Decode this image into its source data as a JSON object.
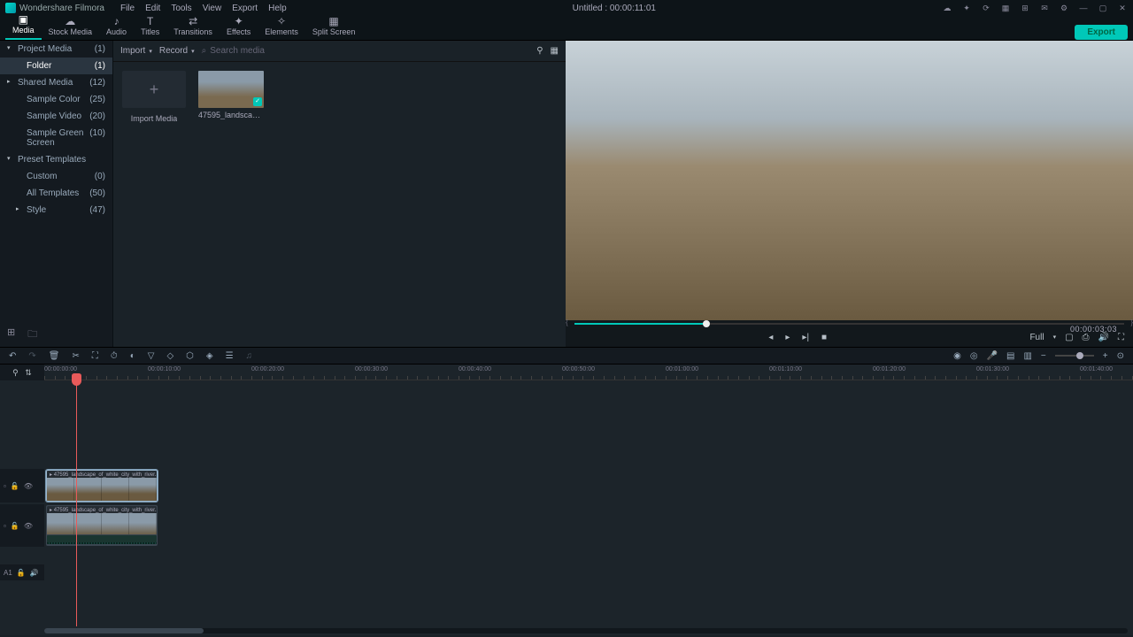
{
  "app_title": "Wondershare Filmora",
  "menu": [
    "File",
    "Edit",
    "Tools",
    "View",
    "Export",
    "Help"
  ],
  "document_title": "Untitled : 00:00:11:01",
  "tabs": [
    {
      "label": "Media",
      "icon": "▣"
    },
    {
      "label": "Stock Media",
      "icon": "☁"
    },
    {
      "label": "Audio",
      "icon": "♪"
    },
    {
      "label": "Titles",
      "icon": "T"
    },
    {
      "label": "Transitions",
      "icon": "⇄"
    },
    {
      "label": "Effects",
      "icon": "✦"
    },
    {
      "label": "Elements",
      "icon": "✧"
    },
    {
      "label": "Split Screen",
      "icon": "▦"
    }
  ],
  "export_label": "Export",
  "sidebar": [
    {
      "label": "Project Media",
      "count": "(1)",
      "arrow": "▾"
    },
    {
      "label": "Folder",
      "count": "(1)",
      "sub": true,
      "selected": true
    },
    {
      "label": "Shared Media",
      "count": "(12)",
      "arrow": "▸"
    },
    {
      "label": "Sample Color",
      "count": "(25)",
      "sub": true
    },
    {
      "label": "Sample Video",
      "count": "(20)",
      "sub": true
    },
    {
      "label": "Sample Green Screen",
      "count": "(10)",
      "sub": true
    },
    {
      "label": "Preset Templates",
      "count": "",
      "arrow": "▾"
    },
    {
      "label": "Custom",
      "count": "(0)",
      "sub": true
    },
    {
      "label": "All Templates",
      "count": "(50)",
      "sub": true
    },
    {
      "label": "Style",
      "count": "(47)",
      "arrow": "▸"
    }
  ],
  "media_toolbar": {
    "import": "Import",
    "record": "Record",
    "search_placeholder": "Search media"
  },
  "media": {
    "import_label": "Import Media",
    "clip_label": "47595_landscape_of_..."
  },
  "preview": {
    "time": "00:00:03:03",
    "full": "Full"
  },
  "ruler_labels": [
    "00:00:00:00",
    "00:00:10:00",
    "00:00:20:00",
    "00:00:30:00",
    "00:00:40:00",
    "00:00:50:00",
    "00:01:00:00",
    "00:01:10:00",
    "00:01:20:00",
    "00:01:30:00",
    "00:01:40:00"
  ],
  "clip_name": "47595_landscape_of_white_city_with_river...",
  "track_video": "▫",
  "track_audio": "A1"
}
